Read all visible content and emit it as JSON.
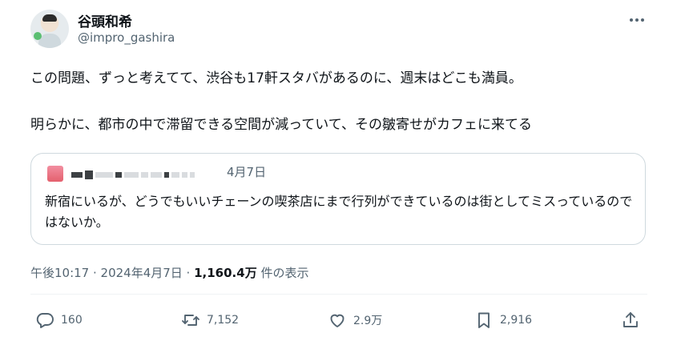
{
  "author": {
    "display_name": "谷頭和希",
    "handle": "@impro_gashira"
  },
  "tweet": {
    "text_line1": "この問題、ずっと考えてて、渋谷も17軒スタバがあるのに、週末はどこも満員。",
    "text_line2": "明らかに、都市の中で滞留できる空間が減っていて、その皺寄せがカフェに来てる"
  },
  "quote": {
    "date": "4月7日",
    "text": "新宿にいるが、どうでもいいチェーンの喫茶店にまで行列ができているのは街としてミスっているのではないか。"
  },
  "meta": {
    "time_date": "午後10:17 · 2024年4月7日 · ",
    "views": "1,160.4万",
    "views_label": " 件の表示"
  },
  "actions": {
    "reply_count": "160",
    "retweet_count": "7,152",
    "like_count": "2.9万",
    "bookmark_count": "2,916"
  },
  "icons": [
    "avatar",
    "more-icon",
    "reply-icon",
    "retweet-icon",
    "like-icon",
    "bookmark-icon",
    "share-icon"
  ]
}
